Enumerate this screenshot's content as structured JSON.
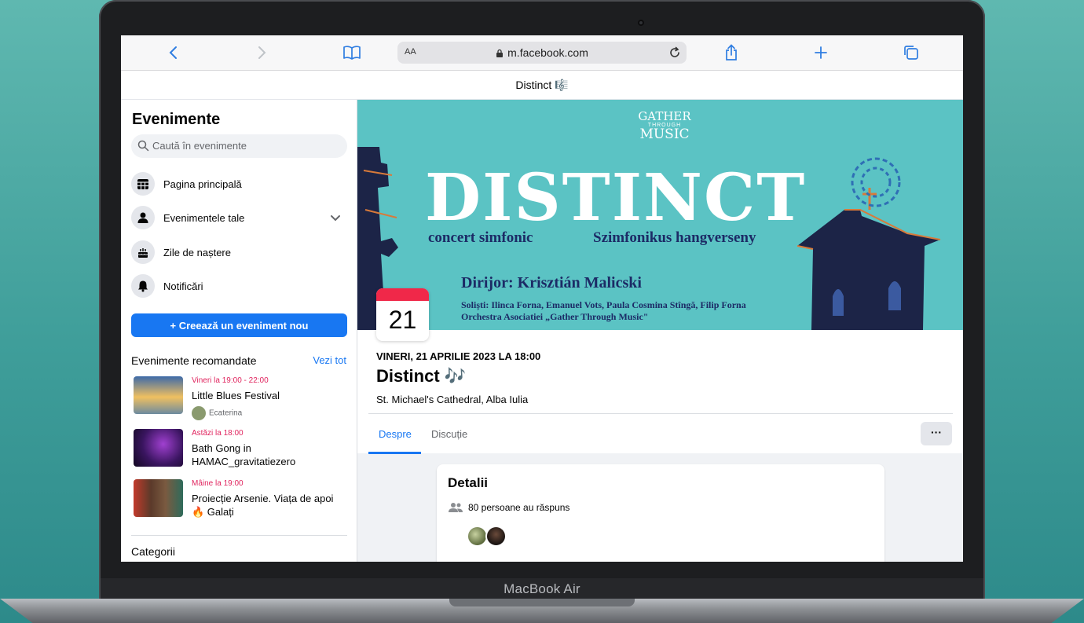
{
  "laptop": {
    "brand": "MacBook Air"
  },
  "browser": {
    "url_aa": "AA",
    "url": "m.facebook.com"
  },
  "page": {
    "title": "Distinct 🎼"
  },
  "sidebar": {
    "title": "Evenimente",
    "search_placeholder": "Caută în evenimente",
    "nav": [
      {
        "label": "Pagina principală",
        "icon": "calendar-grid-icon"
      },
      {
        "label": "Evenimentele tale",
        "icon": "person-icon"
      },
      {
        "label": "Zile de naștere",
        "icon": "cake-icon"
      },
      {
        "label": "Notificări",
        "icon": "bell-icon"
      }
    ],
    "create_button": "+ Creează un eveniment nou",
    "recommended_heading": "Evenimente recomandate",
    "see_all": "Vezi tot",
    "recommended": [
      {
        "time": "Vineri la 19:00 - 22:00",
        "name": "Little Blues Festival",
        "host": "Ecaterina"
      },
      {
        "time": "Astăzi la 18:00",
        "name": "Bath Gong in HAMAC_gravitatiezero"
      },
      {
        "time": "Mâine la 19:00",
        "name": "Proiecție Arsenie. Viața de apoi 🔥 Galați"
      }
    ],
    "categories_heading": "Categorii"
  },
  "event": {
    "cover": {
      "logo_line1": "GATHER",
      "logo_line2": "THROUGH",
      "logo_line3": "MUSIC",
      "headline": "DISTINCT",
      "sub_left": "concert simfonic",
      "sub_right": "Szimfonikus hangverseny",
      "conductor": "Dirijor: Krisztián Malicski",
      "soloists": "Soliști:  Ilinca Forna, Emanuel Vots, Paula Cosmina Stîngă, Filip Forna",
      "orchestra": "Orchestra Asociatiei „Gather Through Music\""
    },
    "day_number": "21",
    "date_line": "VINERI, 21 APRILIE 2023 LA 18:00",
    "title": "Distinct 🎶",
    "place": "St. Michael's Cathedral, Alba Iulia",
    "tabs": [
      "Despre",
      "Discuție"
    ],
    "more_label": "···",
    "details_title": "Detalii",
    "responded": "80 persoane au răspuns"
  },
  "colors": {
    "facebook_blue": "#1877f2",
    "cover_teal": "#5bc3c4",
    "date_red": "#f02849",
    "cover_text_navy": "#1c2b66"
  }
}
